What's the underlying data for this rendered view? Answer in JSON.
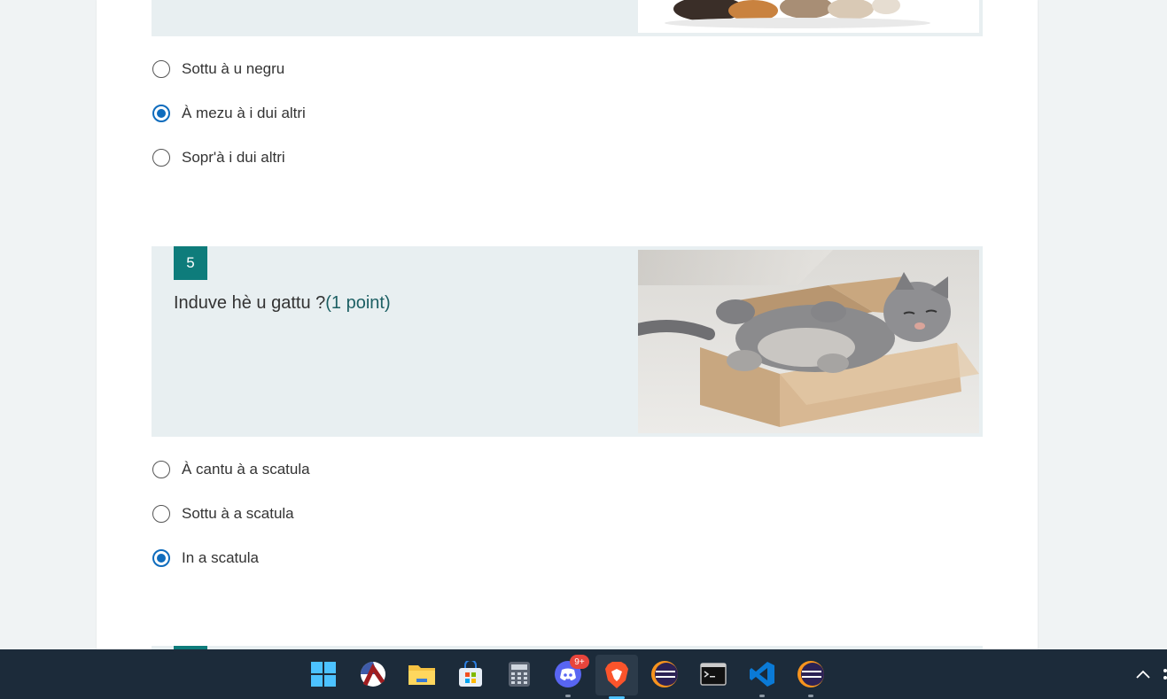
{
  "question4": {
    "options": [
      {
        "label": "Sottu à u negru",
        "checked": false
      },
      {
        "label": "À mezu à i dui altri",
        "checked": true
      },
      {
        "label": "Sopr'à i dui altri",
        "checked": false
      }
    ]
  },
  "question5": {
    "number": "5",
    "text": "Induve hè u gattu ?",
    "points": "(1 point)",
    "options": [
      {
        "label": "À cantu à a scatula",
        "checked": false
      },
      {
        "label": "Sottu à a scatula",
        "checked": false
      },
      {
        "label": "In a scatula",
        "checked": true
      }
    ]
  },
  "taskbar": {
    "discord_badge": "9+",
    "icons": [
      "windows-start-icon",
      "racket-icon",
      "file-explorer-icon",
      "microsoft-store-icon",
      "calculator-icon",
      "discord-icon",
      "brave-browser-icon",
      "eclipse-icon",
      "terminal-icon",
      "vscode-icon",
      "eclipse-icon-2"
    ]
  },
  "colors": {
    "accent": "#0e7c7b",
    "radio_checked": "#0f6cbd",
    "taskbar_bg": "#1c2b3a"
  }
}
